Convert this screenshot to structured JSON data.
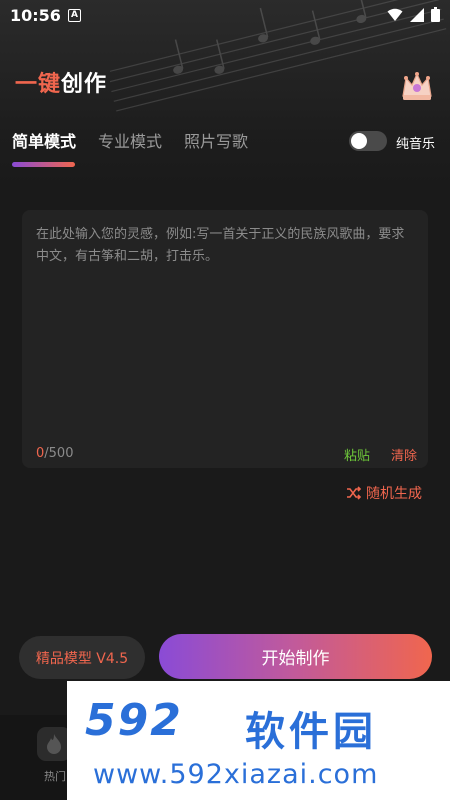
{
  "status_bar": {
    "time": "10:56",
    "badge": "A"
  },
  "app": {
    "title_accent": "一键",
    "title_rest": "创作"
  },
  "tabs": [
    {
      "label": "简单模式",
      "active": true
    },
    {
      "label": "专业模式",
      "active": false
    },
    {
      "label": "照片写歌",
      "active": false
    }
  ],
  "pure_music": {
    "label": "纯音乐",
    "enabled": false
  },
  "prompt": {
    "placeholder": "在此处输入您的灵感，例如:写一首关于正义的民族风歌曲，要求中文，有古筝和二胡，打击乐。",
    "count_current": "0",
    "count_max": "/500",
    "paste_label": "粘贴",
    "clear_label": "清除"
  },
  "random": {
    "label": "随机生成"
  },
  "model": {
    "label": "精品模型 V4.5"
  },
  "start": {
    "label": "开始制作"
  },
  "bottom_nav": {
    "item_label": "热门"
  },
  "watermark": {
    "brand_num": "592",
    "brand_cn": "软件园",
    "url": "www.592xiazai.com"
  },
  "colors": {
    "accent": "#f0664e",
    "purple": "#8a4bd6",
    "green": "#6ec83a",
    "bg": "#1a1a1a"
  }
}
